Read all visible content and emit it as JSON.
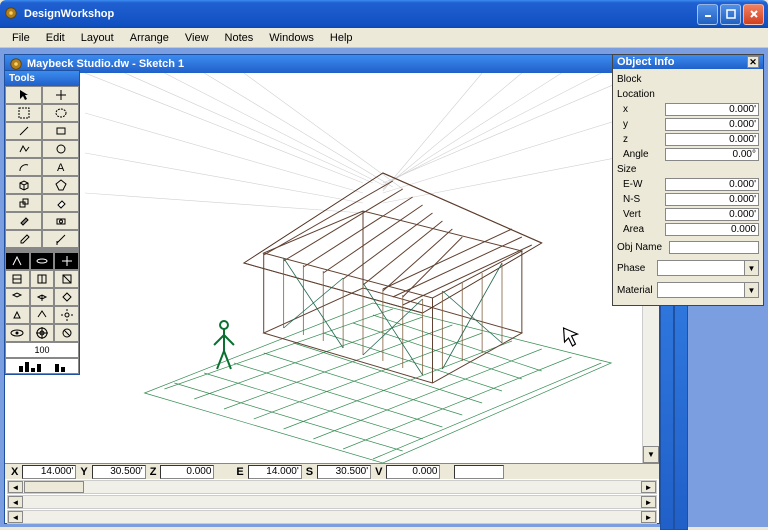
{
  "app": {
    "title": "DesignWorkshop"
  },
  "menu": {
    "items": [
      "File",
      "Edit",
      "Layout",
      "Arrange",
      "View",
      "Notes",
      "Windows",
      "Help"
    ]
  },
  "doc": {
    "title": "Maybeck Studio.dw - Sketch 1"
  },
  "tools": {
    "title": "Tools",
    "zoom_value": "100"
  },
  "status": {
    "x_lbl": "X",
    "x": "14.000'",
    "y_lbl": "Y",
    "y": "30.500'",
    "z_lbl": "Z",
    "z": "0.000",
    "e_lbl": "E",
    "e": "14.000'",
    "s_lbl": "S",
    "s": "30.500'",
    "v_lbl": "V",
    "v": "0.000"
  },
  "objinfo": {
    "title": "Object Info",
    "block_lbl": "Block",
    "location_lbl": "Location",
    "x_lbl": "x",
    "x": "0.000'",
    "y_lbl": "y",
    "y": "0.000'",
    "z_lbl": "z",
    "z": "0.000'",
    "angle_lbl": "Angle",
    "angle": "0.00°",
    "size_lbl": "Size",
    "ew_lbl": "E-W",
    "ew": "0.000'",
    "ns_lbl": "N-S",
    "ns": "0.000'",
    "vert_lbl": "Vert",
    "vert": "0.000'",
    "area_lbl": "Area",
    "area": "0.000",
    "objname_lbl": "Obj Name",
    "objname": "",
    "phase_lbl": "Phase",
    "phase": "",
    "material_lbl": "Material",
    "material": ""
  }
}
